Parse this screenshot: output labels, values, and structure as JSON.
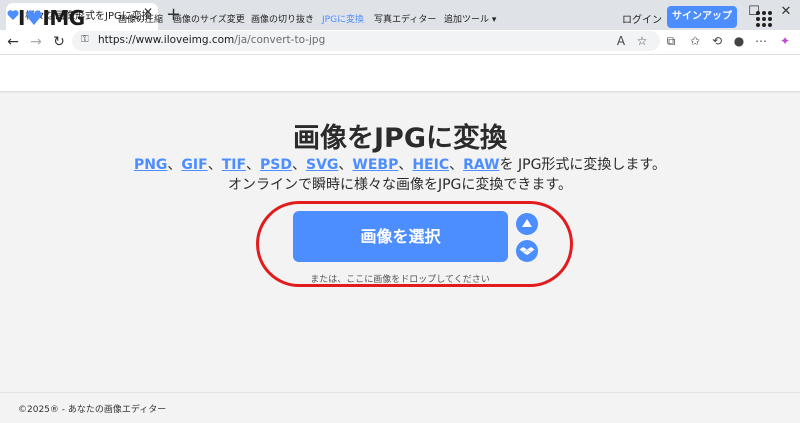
{
  "browser": {
    "tab_title": "様々な画像形式をJPGに変換",
    "tab_close": "✕",
    "new_tab": "+",
    "window_controls": [
      "—",
      "☐",
      "✕"
    ],
    "url_host": "https://www.iloveimg.com",
    "url_path": "/ja/convert-to-jpg",
    "nav_icons": [
      "back-icon",
      "forward-icon",
      "refresh-icon"
    ],
    "toolbar_icons": [
      "read-aloud-icon",
      "favorite-icon",
      "extensions-icon",
      "favorites-icon",
      "history-icon",
      "profile-icon",
      "more-icon",
      "copilot-icon"
    ]
  },
  "header": {
    "logo_left": "I",
    "logo_heart": "♥",
    "logo_right": "IMG",
    "nav": [
      {
        "label": "画像の圧縮"
      },
      {
        "label": "画像のサイズ変更"
      },
      {
        "label": "画像の切り抜き"
      },
      {
        "label": "JPGに変換",
        "active": true
      },
      {
        "label": "写真エディター"
      },
      {
        "label": "追加ツール ▾"
      }
    ],
    "login": "ログイン",
    "signup": "サインアップ"
  },
  "main": {
    "title": "画像をJPGに変換",
    "formats": [
      "PNG",
      "GIF",
      "TIF",
      "PSD",
      "SVG",
      "WEBP",
      "HEIC",
      "RAW"
    ],
    "formats_suffix": "を JPG形式に変換します。",
    "subtitle2": "オンラインで瞬時に様々な画像をJPGに変換できます。",
    "select_button": "画像を選択",
    "drop_text": "または、ここに画像をドロップしてください"
  },
  "footer": {
    "text": "©2025® - あなたの画像エディター"
  },
  "colors": {
    "accent": "#4c8dff",
    "annotation": "#e21b1b"
  }
}
